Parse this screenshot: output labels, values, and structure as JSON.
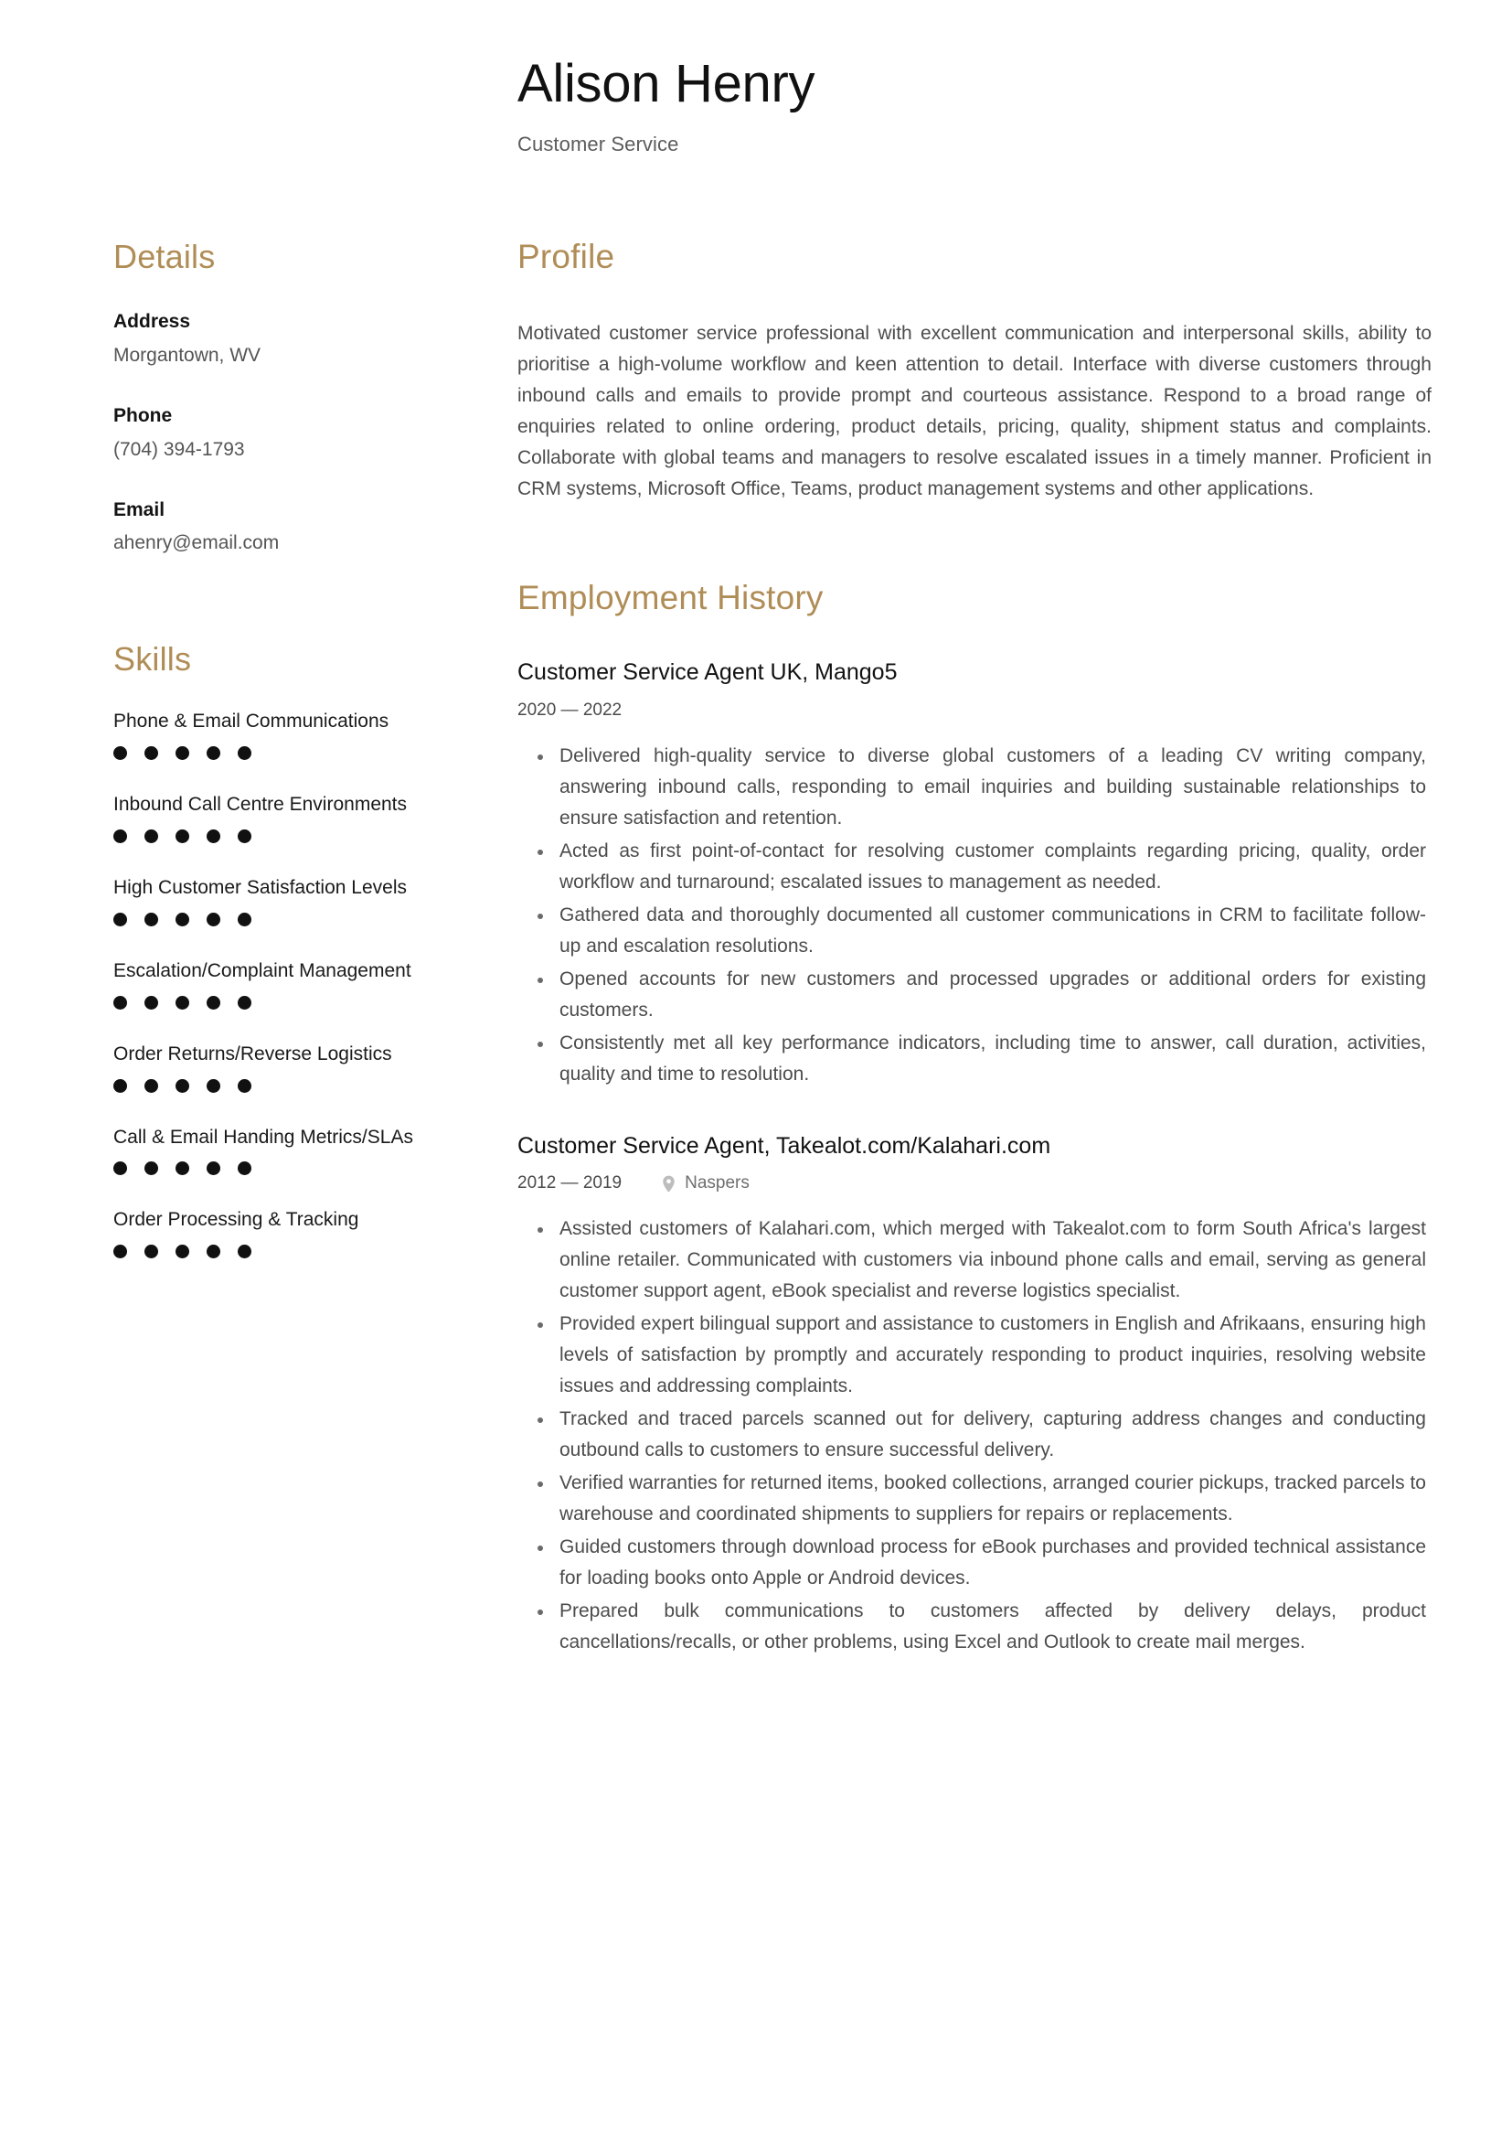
{
  "header": {
    "full_name": "Alison Henry",
    "job_title": "Customer Service"
  },
  "sidebar": {
    "details": {
      "heading": "Details",
      "fields": [
        {
          "label": "Address",
          "value": "Morgantown, WV"
        },
        {
          "label": "Phone",
          "value": "(704) 394-1793"
        },
        {
          "label": "Email",
          "value": "ahenry@email.com"
        }
      ]
    },
    "skills": {
      "heading": "Skills",
      "items": [
        {
          "name": "Phone & Email Communications",
          "rating": 5,
          "max": 5
        },
        {
          "name": "Inbound Call Centre Environments",
          "rating": 5,
          "max": 5
        },
        {
          "name": "High Customer Satisfaction Levels",
          "rating": 5,
          "max": 5
        },
        {
          "name": "Escalation/Complaint Management",
          "rating": 5,
          "max": 5
        },
        {
          "name": "Order Returns/Reverse Logistics",
          "rating": 5,
          "max": 5
        },
        {
          "name": "Call & Email Handing Metrics/SLAs",
          "rating": 5,
          "max": 5
        },
        {
          "name": "Order Processing & Tracking",
          "rating": 5,
          "max": 5
        }
      ]
    }
  },
  "main": {
    "profile": {
      "heading": "Profile",
      "text": "Motivated customer service professional with excellent communication and interpersonal skills, ability to prioritise a high-volume workflow and keen attention to detail. Interface with diverse customers through inbound calls and emails to provide prompt and courteous assistance. Respond to a broad range of enquiries related to online ordering, product details, pricing, quality, shipment status and complaints. Collaborate with global teams and managers to resolve escalated issues in a timely manner. Proficient in CRM systems, Microsoft Office, Teams, product management systems and other applications."
    },
    "employment": {
      "heading": "Employment History",
      "jobs": [
        {
          "title": "Customer Service Agent UK, Mango5",
          "dates": "2020 — 2022",
          "location": "",
          "bullets": [
            "Delivered high-quality service to diverse global customers of a leading CV writing company, answering inbound calls, responding to email inquiries and building sustainable relationships to ensure satisfaction and retention.",
            "Acted as first point-of-contact for resolving customer complaints regarding pricing, quality, order workflow and turnaround; escalated issues to management as needed.",
            "Gathered data and thoroughly documented all customer communications in CRM to facilitate follow-up and escalation resolutions.",
            "Opened accounts for new customers and processed upgrades or additional orders for existing customers.",
            "Consistently met all key performance indicators, including time to answer, call duration, activities, quality and time to resolution."
          ]
        },
        {
          "title": "Customer Service Agent, Takealot.com/Kalahari.com",
          "dates": "2012 — 2019",
          "location": "Naspers",
          "bullets": [
            "Assisted customers of Kalahari.com, which merged with Takealot.com to form South Africa's largest online retailer. Communicated with customers via inbound phone calls and email, serving as general customer support agent, eBook specialist and reverse logistics specialist.",
            "Provided expert bilingual support and assistance to customers in English and Afrikaans, ensuring high levels of satisfaction by promptly and accurately responding to product inquiries, resolving website issues and addressing complaints.",
            "Tracked and traced parcels scanned out for delivery, capturing address changes and conducting outbound calls to customers to ensure successful delivery.",
            "Verified warranties for returned items, booked collections, arranged courier pickups, tracked parcels to warehouse and coordinated shipments to suppliers for repairs or replacements.",
            "Guided customers through download process for eBook purchases and provided technical assistance for loading books onto Apple or Android devices.",
            "Prepared bulk communications to customers affected by delivery delays, product cancellations/recalls, or other problems, using Excel and Outlook to create mail merges."
          ]
        }
      ]
    }
  },
  "theme": {
    "accent_color": "#b08d57",
    "text_color": "#4c4c4c",
    "heading_color": "#111111",
    "dot_color": "#111111",
    "background": "#ffffff"
  },
  "icons": {
    "location_pin": "location-pin-icon"
  }
}
